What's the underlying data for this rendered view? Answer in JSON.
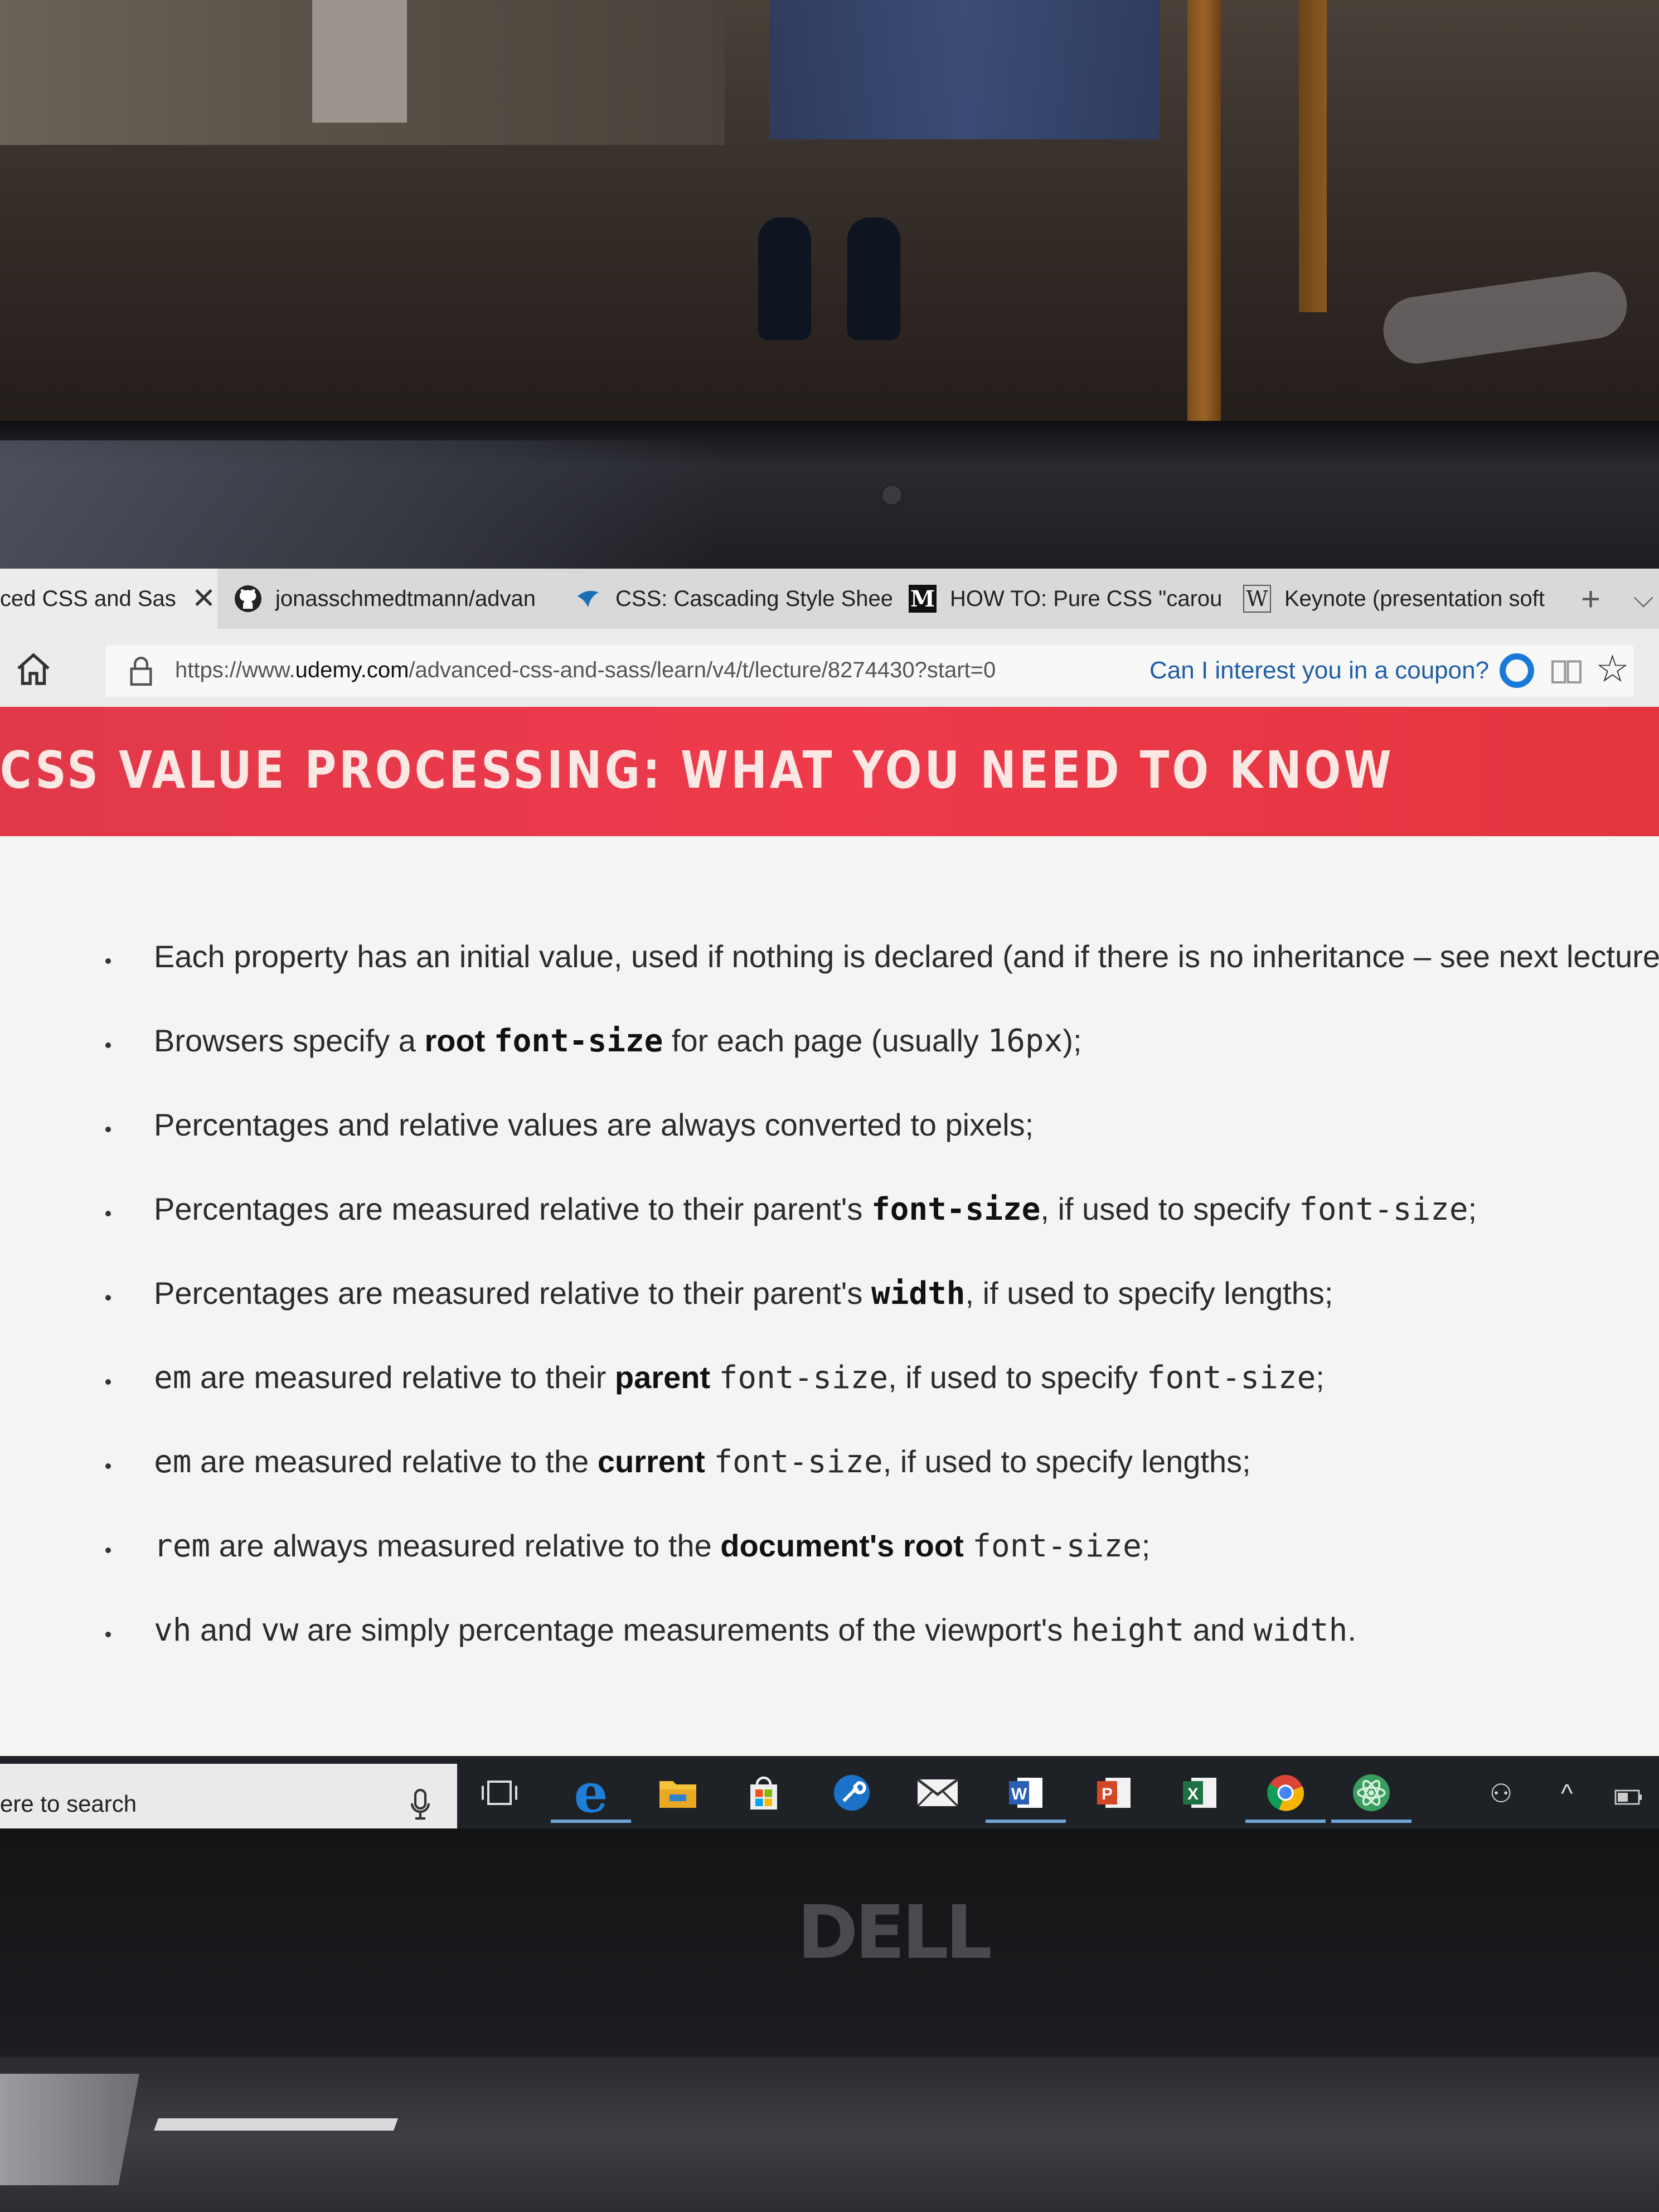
{
  "browser": {
    "tabs": [
      {
        "title": "ced CSS and Sas",
        "active": true,
        "icon": "udemy-icon"
      },
      {
        "title": "jonasschmedtmann/advan",
        "icon": "github-icon"
      },
      {
        "title": "CSS: Cascading Style Shee",
        "icon": "mdn-icon"
      },
      {
        "title": "HOW TO: Pure CSS \"carou",
        "icon": "medium-icon",
        "icon_text": "M"
      },
      {
        "title": "Keynote (presentation soft",
        "icon": "wikipedia-icon",
        "icon_text": "W"
      }
    ],
    "new_tab_symbol": "+",
    "tab_overflow_symbol": "⌵",
    "close_symbol": "✕",
    "url_prefix": "https://www.",
    "url_domain": "udemy.com",
    "url_path": "/advanced-css-and-sass/learn/v4/t/lecture/8274430?start=0",
    "coupon_prompt": "Can I interest you in a coupon?",
    "favorite_symbol": "☆"
  },
  "slide": {
    "title": "CSS VALUE PROCESSING: WHAT YOU NEED TO KNOW",
    "accent_color": "#ee3a4b",
    "bullets": [
      [
        {
          "t": "Each property has an initial value, used if nothing is declared (and if there is no inheritance – see next lecture);"
        }
      ],
      [
        {
          "t": "Browsers specify a "
        },
        {
          "t": "root",
          "s": "b"
        },
        {
          "t": " "
        },
        {
          "t": "font-size",
          "s": "bm"
        },
        {
          "t": " for each page (usually "
        },
        {
          "t": "16px",
          "s": "m"
        },
        {
          "t": ");"
        }
      ],
      [
        {
          "t": "Percentages and relative values are always converted to pixels;"
        }
      ],
      [
        {
          "t": "Percentages are measured relative to their parent's "
        },
        {
          "t": "font-size",
          "s": "bm"
        },
        {
          "t": ", if used to specify "
        },
        {
          "t": "font-size",
          "s": "m"
        },
        {
          "t": ";"
        }
      ],
      [
        {
          "t": "Percentages are measured relative to their parent's "
        },
        {
          "t": "width",
          "s": "bm"
        },
        {
          "t": ", if used to specify lengths;"
        }
      ],
      [
        {
          "t": "em",
          "s": "m"
        },
        {
          "t": " are measured relative to their "
        },
        {
          "t": "parent",
          "s": "b"
        },
        {
          "t": " "
        },
        {
          "t": "font-size",
          "s": "m"
        },
        {
          "t": ", if used to specify "
        },
        {
          "t": "font-size",
          "s": "m"
        },
        {
          "t": ";"
        }
      ],
      [
        {
          "t": "em",
          "s": "m"
        },
        {
          "t": " are measured relative to the "
        },
        {
          "t": "current",
          "s": "b"
        },
        {
          "t": " "
        },
        {
          "t": "font-size",
          "s": "m"
        },
        {
          "t": ", if used to specify lengths;"
        }
      ],
      [
        {
          "t": "rem",
          "s": "m"
        },
        {
          "t": " are always measured relative to the "
        },
        {
          "t": "document's root",
          "s": "b"
        },
        {
          "t": " "
        },
        {
          "t": "font-size",
          "s": "m"
        },
        {
          "t": ";"
        }
      ],
      [
        {
          "t": "vh",
          "s": "m"
        },
        {
          "t": " and "
        },
        {
          "t": "vw",
          "s": "m"
        },
        {
          "t": " are simply percentage measurements of the viewport's "
        },
        {
          "t": "height",
          "s": "m"
        },
        {
          "t": " and "
        },
        {
          "t": "width",
          "s": "m"
        },
        {
          "t": "."
        }
      ]
    ]
  },
  "taskbar": {
    "search_placeholder": "ere to search",
    "apps": [
      "task-view",
      "edge",
      "file-explorer",
      "store",
      "app-wrench",
      "mail",
      "word",
      "powerpoint",
      "excel",
      "chrome",
      "atom"
    ],
    "tray": {
      "people_symbol": "⚇",
      "chevron_symbol": "^"
    }
  },
  "device": {
    "brand": "DELL"
  }
}
